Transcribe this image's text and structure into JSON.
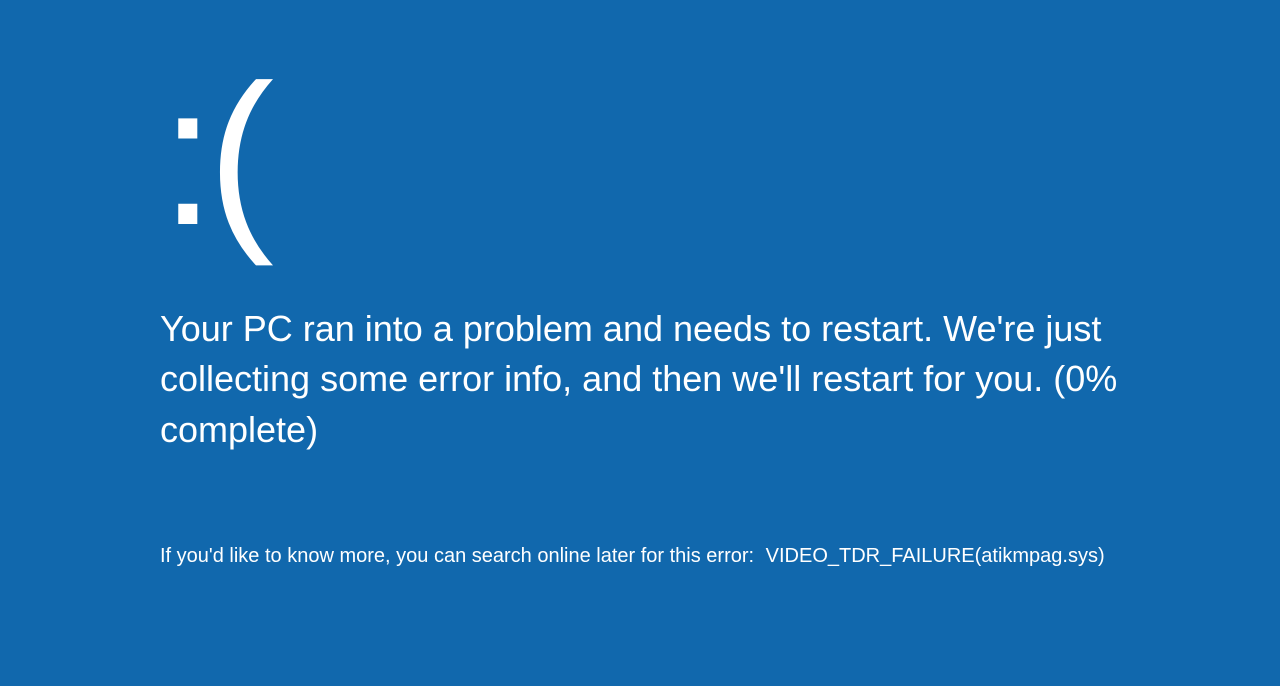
{
  "bsod": {
    "emoticon": ":(",
    "message": "Your PC ran into a problem and needs to restart. We're just collecting some error info, and then we'll restart for you. (0% complete)",
    "details_prefix": "If you'd like to know more, you can search online later for this error:",
    "error_code": "VIDEO_TDR_FAILURE(atikmpag.sys)"
  }
}
